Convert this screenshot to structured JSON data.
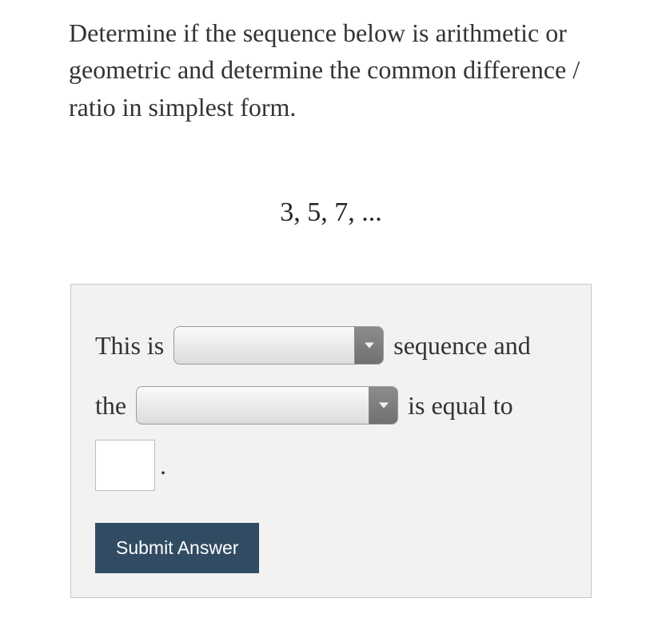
{
  "question": "Determine if the sequence below is arithmetic or geometric and determine the common difference / ratio in simplest form.",
  "sequence_display": "3,  5,  7,  ...",
  "answer": {
    "prefix1": "This is",
    "middle1": "sequence and",
    "prefix2": "the",
    "middle2": "is equal to",
    "period": ".",
    "dropdown1_value": "",
    "dropdown2_value": "",
    "input_value": ""
  },
  "submit_label": "Submit Answer"
}
